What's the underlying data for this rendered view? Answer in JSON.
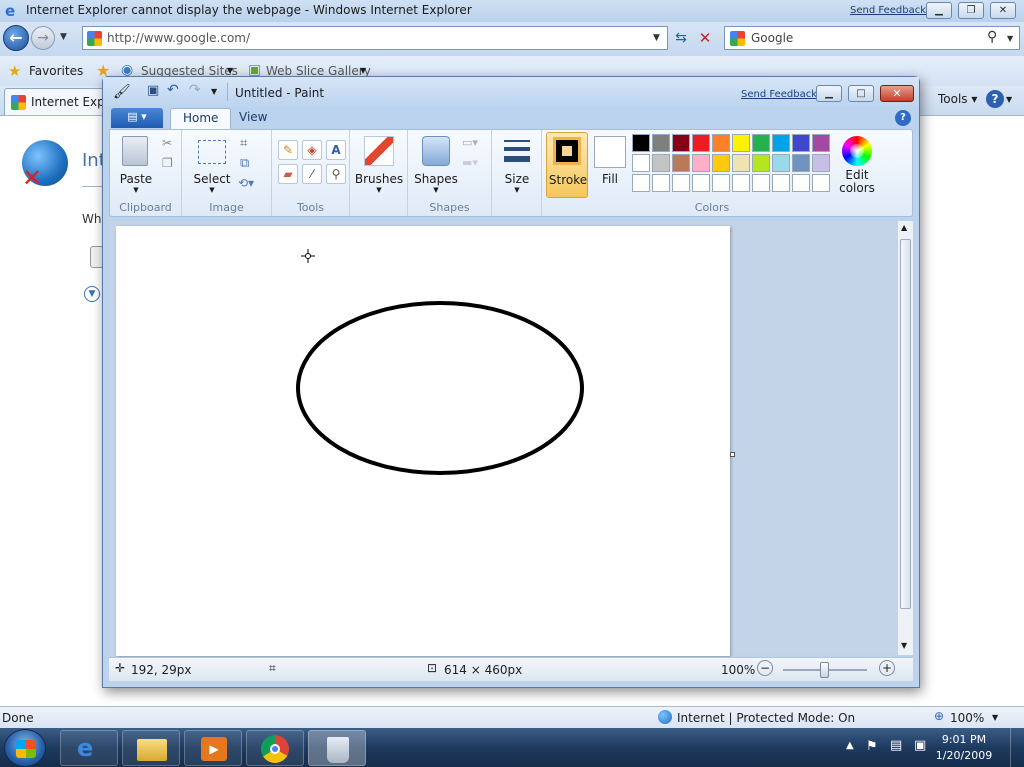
{
  "ie": {
    "title": "Internet Explorer cannot display the webpage - Windows Internet Explorer",
    "send_feedback": "Send Feedback",
    "address": "http://www.google.com/",
    "search_placeholder": "Google",
    "favorites": "Favorites",
    "suggested_sites": "Suggested Sites",
    "web_slice_gallery": "Web Slice Gallery",
    "tab_title": "Internet Explo",
    "tools": "Tools",
    "content_heading": "Int",
    "content_text": "Wh",
    "status_left": "Done",
    "status_zone": "Internet | Protected Mode: On",
    "status_zoom": "100%"
  },
  "paint": {
    "title": "Untitled - Paint",
    "send_feedback": "Send Feedback",
    "tabs": [
      "Home",
      "View"
    ],
    "groups": {
      "clipboard": "Clipboard",
      "image": "Image",
      "tools": "Tools",
      "shapes": "Shapes",
      "colors": "Colors"
    },
    "buttons": {
      "paste": "Paste",
      "select": "Select",
      "brushes": "Brushes",
      "shapes": "Shapes",
      "size": "Size",
      "stroke": "Stroke",
      "fill": "Fill",
      "edit_colors_1": "Edit",
      "edit_colors_2": "colors"
    },
    "palette_row1": [
      "#000000",
      "#7f7f7f",
      "#880015",
      "#ed1c24",
      "#ff7f27",
      "#fff200",
      "#22b14c",
      "#00a2e8",
      "#3f48cc",
      "#a349a4"
    ],
    "palette_row2": [
      "#ffffff",
      "#c3c3c3",
      "#b97a57",
      "#ffaec9",
      "#ffc90e",
      "#efe4b0",
      "#b5e61d",
      "#99d9ea",
      "#7092be",
      "#c8bfe7"
    ],
    "palette_row3": [
      "#ffffff",
      "#ffffff",
      "#ffffff",
      "#ffffff",
      "#ffffff",
      "#ffffff",
      "#ffffff",
      "#ffffff",
      "#ffffff",
      "#ffffff"
    ],
    "status": {
      "cursor_pos": "192, 29px",
      "image_size": "614 × 460px",
      "zoom": "100%"
    }
  },
  "taskbar": {
    "time": "9:01 PM",
    "date": "1/20/2009"
  }
}
